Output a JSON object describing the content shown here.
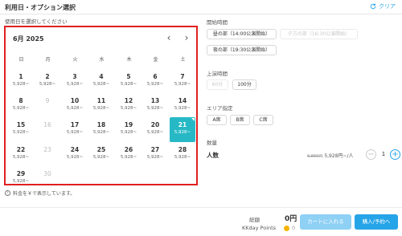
{
  "header": {
    "title": "利用日・オプション選択",
    "clear_label": "クリア"
  },
  "calendar": {
    "instruction": "使用日を選択してください",
    "month_label": "6月 2025",
    "weekdays": [
      "日",
      "月",
      "火",
      "水",
      "木",
      "金",
      "土"
    ],
    "days": [
      {
        "num": "1",
        "price": "5,928~",
        "state": "available"
      },
      {
        "num": "2",
        "price": "5,928~",
        "state": "available"
      },
      {
        "num": "3",
        "price": "5,928~",
        "state": "available"
      },
      {
        "num": "4",
        "price": "5,928~",
        "state": "available"
      },
      {
        "num": "5",
        "price": "5,928~",
        "state": "available"
      },
      {
        "num": "6",
        "price": "5,928~",
        "state": "available"
      },
      {
        "num": "7",
        "price": "5,928~",
        "state": "available"
      },
      {
        "num": "8",
        "price": "5,928~",
        "state": "available"
      },
      {
        "num": "9",
        "price": "",
        "state": "disabled"
      },
      {
        "num": "10",
        "price": "5,928~",
        "state": "available"
      },
      {
        "num": "11",
        "price": "5,928~",
        "state": "available"
      },
      {
        "num": "12",
        "price": "5,928~",
        "state": "available"
      },
      {
        "num": "13",
        "price": "5,928~",
        "state": "available"
      },
      {
        "num": "14",
        "price": "5,928~",
        "state": "available"
      },
      {
        "num": "15",
        "price": "5,928~",
        "state": "available"
      },
      {
        "num": "16",
        "price": "",
        "state": "disabled"
      },
      {
        "num": "17",
        "price": "5,928~",
        "state": "available"
      },
      {
        "num": "18",
        "price": "5,928~",
        "state": "available"
      },
      {
        "num": "19",
        "price": "5,928~",
        "state": "available"
      },
      {
        "num": "20",
        "price": "5,928~",
        "state": "available"
      },
      {
        "num": "21",
        "price": "5,928~",
        "state": "selected"
      },
      {
        "num": "22",
        "price": "5,928~",
        "state": "available"
      },
      {
        "num": "23",
        "price": "",
        "state": "disabled"
      },
      {
        "num": "24",
        "price": "5,928~",
        "state": "available"
      },
      {
        "num": "25",
        "price": "5,928~",
        "state": "available"
      },
      {
        "num": "26",
        "price": "5,928~",
        "state": "available"
      },
      {
        "num": "27",
        "price": "5,928~",
        "state": "available"
      },
      {
        "num": "28",
        "price": "5,928~",
        "state": "available"
      },
      {
        "num": "29",
        "price": "5,928~",
        "state": "available"
      },
      {
        "num": "30",
        "price": "",
        "state": "disabled"
      }
    ],
    "note": "料金を￥で表示しています。"
  },
  "options": {
    "start_time": {
      "label": "開始時間",
      "items": [
        {
          "label": "昼の部（14:00公演開始）",
          "disabled": false
        },
        {
          "label": "夕方の部（16:30公演開始）",
          "disabled": true
        },
        {
          "label": "夜の部（19:30公演開始）",
          "disabled": false
        }
      ]
    },
    "duration": {
      "label": "上演時間",
      "items": [
        {
          "label": "60分",
          "disabled": true
        },
        {
          "label": "100分",
          "disabled": false
        }
      ]
    },
    "area": {
      "label": "エリア指定",
      "items": [
        {
          "label": "A席",
          "disabled": false
        },
        {
          "label": "B席",
          "disabled": false
        },
        {
          "label": "C席",
          "disabled": false
        }
      ]
    }
  },
  "quantity": {
    "section_label": "数量",
    "item_label": "人数",
    "original_price": "6,869円",
    "price": "5,928円~/人",
    "value": "1",
    "minus": "−",
    "plus": "+"
  },
  "footer": {
    "total_label": "総額",
    "total_value": "0円",
    "points_label": "KKday Points",
    "points_value": "0",
    "cart_button": "カートに入れる",
    "buy_button": "購入/予約へ"
  },
  "colors": {
    "accent": "#26a4e8",
    "selected_day": "#26b9c5",
    "highlight_border": "#e02020"
  }
}
